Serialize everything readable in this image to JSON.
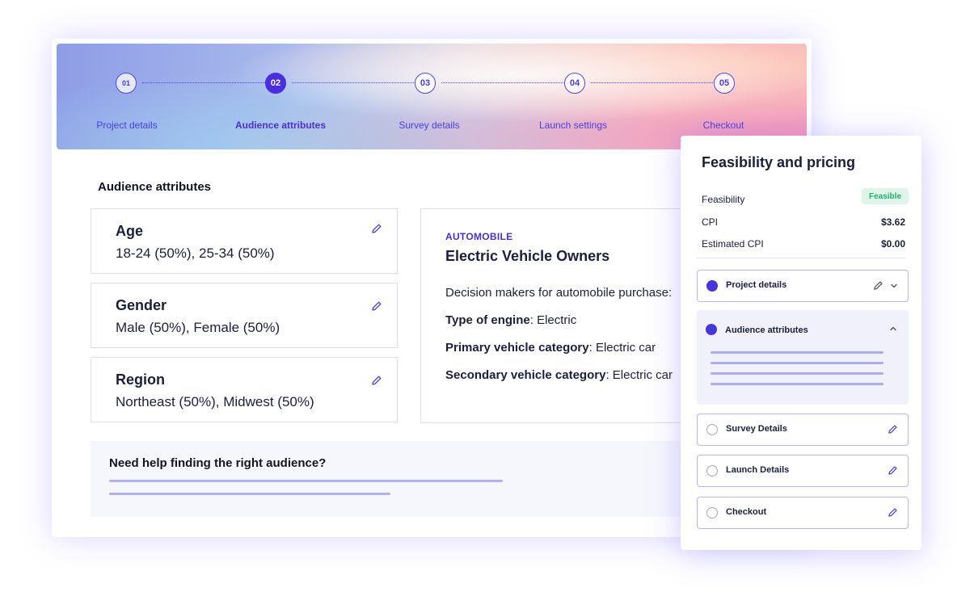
{
  "stepper": {
    "steps": [
      {
        "number": "01",
        "label": "Project details",
        "active": false
      },
      {
        "number": "02",
        "label": "Audience attributes",
        "active": true
      },
      {
        "number": "03",
        "label": "Survey details",
        "active": false
      },
      {
        "number": "04",
        "label": "Launch settings",
        "active": false
      },
      {
        "number": "05",
        "label": "Checkout",
        "active": false
      }
    ]
  },
  "audience": {
    "title": "Audience attributes",
    "attributes": [
      {
        "name": "Age",
        "value": "18-24 (50%), 25-34 (50%)",
        "icon": "pencil-icon"
      },
      {
        "name": "Gender",
        "value": "Male (50%), Female (50%)",
        "icon": "pencil-icon"
      },
      {
        "name": "Region",
        "value": "Northeast (50%), Midwest (50%)",
        "icon": "pencil-icon"
      }
    ]
  },
  "vehicle_card": {
    "category": "AUTOMOBILE",
    "title": "Electric Vehicle Owners",
    "rows": [
      {
        "label": "Decision makers for automobile purchase:",
        "value": ""
      },
      {
        "label": "Type of engine",
        "value": ": Electric"
      },
      {
        "label": "Primary vehicle category",
        "value": ": Electric car"
      },
      {
        "label": "Secondary vehicle category",
        "value": ": Electric car"
      }
    ]
  },
  "help": {
    "title": "Need help finding the right audience?"
  },
  "pricing_panel": {
    "title": "Feasibility and pricing",
    "feasibility_label": "Feasibility",
    "feasibility_status": "Feasible",
    "cpi_label": "CPI",
    "cpi_value": "$3.62",
    "estimated_cpi_label": "Estimated CPI",
    "estimated_cpi_value": "$0.00",
    "sections": [
      {
        "label": "Project details",
        "state": "complete",
        "expanded": false
      },
      {
        "label": "Audience attributes",
        "state": "complete",
        "expanded": true
      },
      {
        "label": "Survey Details",
        "state": "pending",
        "expanded": false
      },
      {
        "label": "Launch Details",
        "state": "pending",
        "expanded": false
      },
      {
        "label": "Checkout",
        "state": "pending",
        "expanded": false
      }
    ]
  },
  "colors": {
    "accent": "#4a2fe0",
    "feasible_green": "#20b36a",
    "feasible_bg": "#dff5ea",
    "placeholder_line": "#b3b0f2"
  }
}
